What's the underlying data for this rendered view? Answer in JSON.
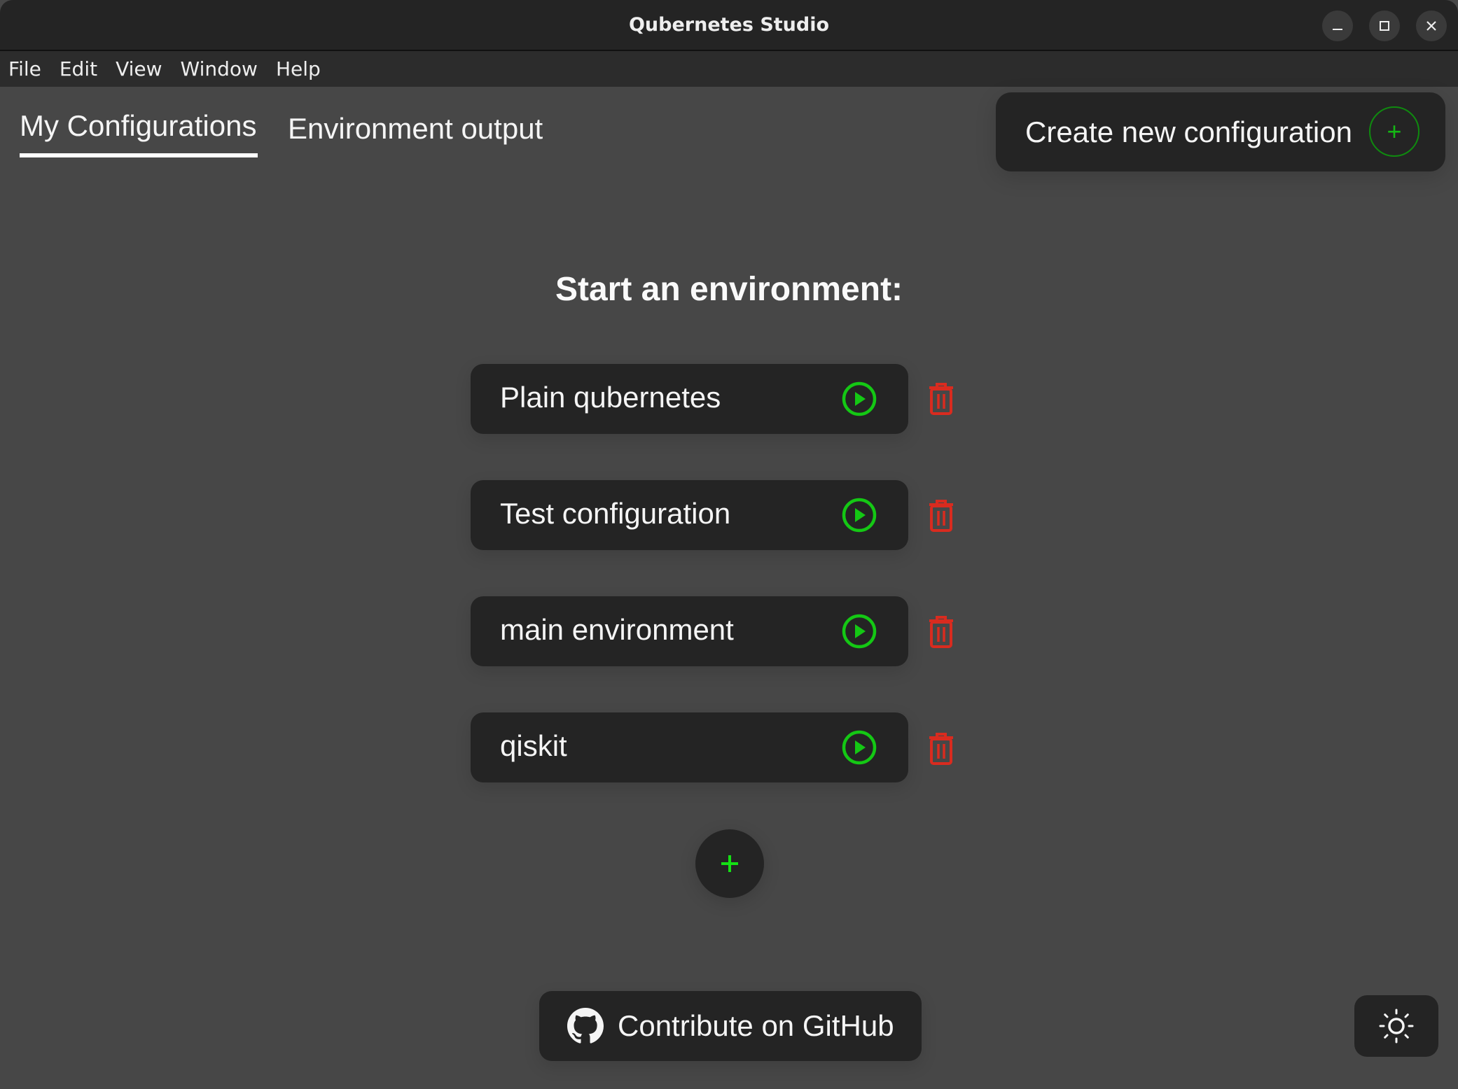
{
  "window": {
    "title": "Qubernetes Studio",
    "controls": {
      "minimize": "–",
      "maximize": "□",
      "close": "✕"
    }
  },
  "menubar": {
    "items": [
      "File",
      "Edit",
      "View",
      "Window",
      "Help"
    ]
  },
  "tabs": [
    {
      "label": "My Configurations",
      "active": true
    },
    {
      "label": "Environment output",
      "active": false
    }
  ],
  "toolbar": {
    "create_label": "Create new configuration",
    "create_icon": "+"
  },
  "main": {
    "heading": "Start an environment:",
    "configurations": [
      {
        "name": "Plain qubernetes"
      },
      {
        "name": "Test configuration"
      },
      {
        "name": "main environment"
      },
      {
        "name": "qiskit"
      }
    ],
    "add_icon": "+"
  },
  "footer": {
    "github_label": "Contribute on GitHub",
    "theme_icon": "sun-icon"
  },
  "colors": {
    "accent_green": "#14c814",
    "danger_red": "#d92b1f",
    "surface": "#242424",
    "background": "#474747"
  }
}
